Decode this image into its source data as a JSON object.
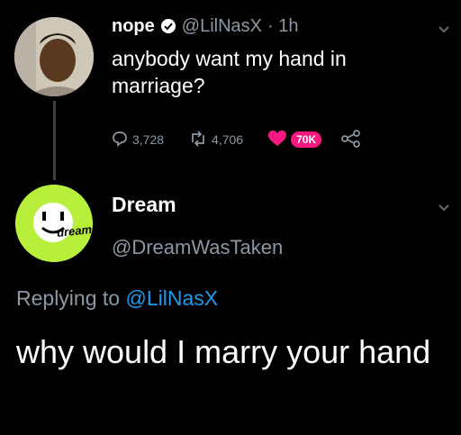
{
  "tweet": {
    "display_name": "nope",
    "handle": "@LilNasX",
    "time": "· 1h",
    "text": "anybody want my hand in marriage?",
    "replies": "3,728",
    "retweets": "4,706",
    "likes": "70K",
    "verified_icon": "verified-badge-icon",
    "like_color": "#f91880"
  },
  "reply": {
    "display_name": "Dream",
    "handle": "@DreamWasTaken",
    "replying_prefix": "Replying to",
    "replying_handle": "@LilNasX",
    "text": "why would I marry your hand",
    "avatar_text": "dream"
  },
  "colors": {
    "background": "#000000",
    "muted": "#8b98a5",
    "link": "#1d9bf0",
    "dream_green": "#b8ef3a"
  }
}
